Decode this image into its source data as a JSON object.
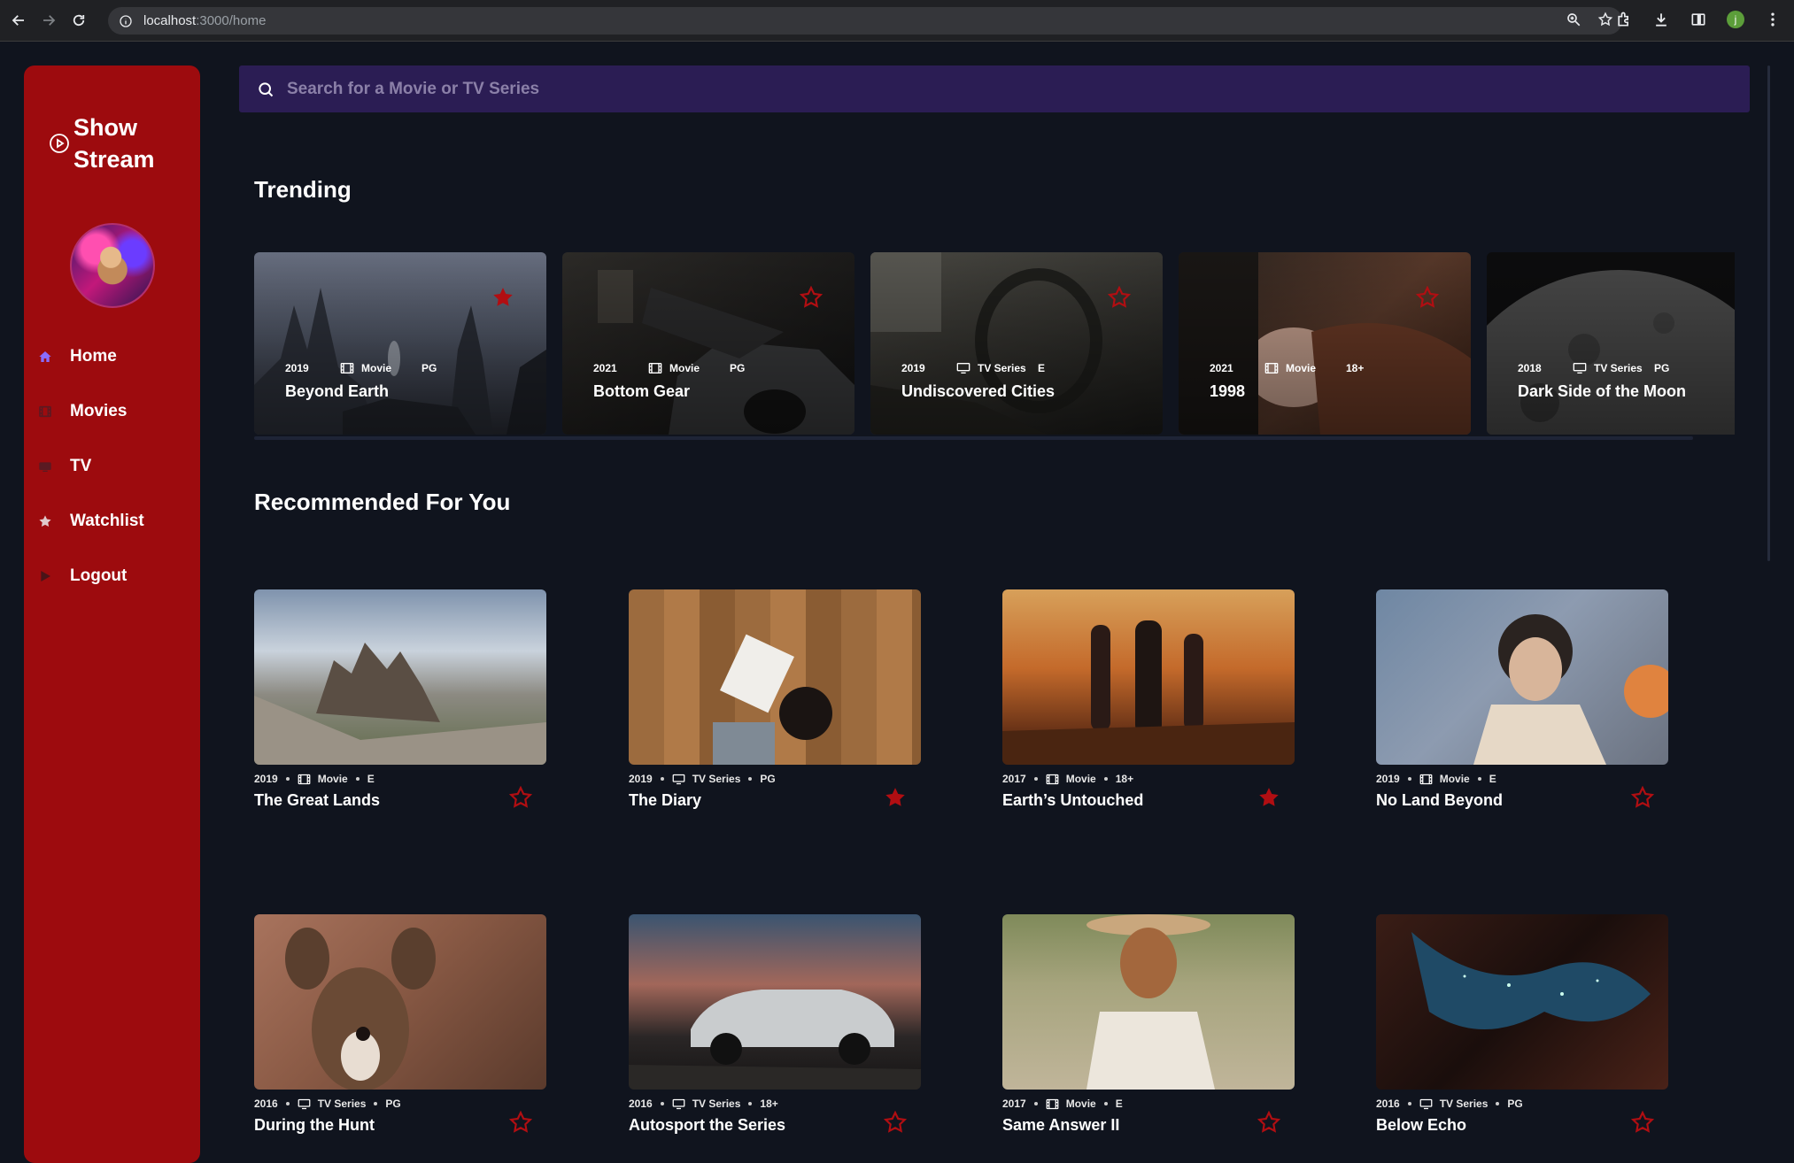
{
  "browser": {
    "url_host": "localhost",
    "url_path": ":3000/home"
  },
  "sidebar": {
    "logo_text": "Show Stream",
    "nav": [
      {
        "label": "Home"
      },
      {
        "label": "Movies"
      },
      {
        "label": "TV"
      },
      {
        "label": "Watchlist"
      },
      {
        "label": "Logout"
      }
    ]
  },
  "search": {
    "placeholder": "Search for a Movie or TV Series"
  },
  "trending": {
    "title": "Trending",
    "items": [
      {
        "year": "2019",
        "type": "Movie",
        "rating": "PG",
        "title": "Beyond Earth",
        "bookmarked": true
      },
      {
        "year": "2021",
        "type": "Movie",
        "rating": "PG",
        "title": "Bottom Gear",
        "bookmarked": false
      },
      {
        "year": "2019",
        "type": "TV Series",
        "rating": "E",
        "title": "Undiscovered Cities",
        "bookmarked": false
      },
      {
        "year": "2021",
        "type": "Movie",
        "rating": "18+",
        "title": "1998",
        "bookmarked": false
      },
      {
        "year": "2018",
        "type": "TV Series",
        "rating": "PG",
        "title": "Dark Side of the Moon",
        "bookmarked": false
      }
    ]
  },
  "recommended": {
    "title": "Recommended For You",
    "items": [
      {
        "year": "2019",
        "type": "Movie",
        "rating": "E",
        "title": "The Great Lands",
        "bookmarked": false
      },
      {
        "year": "2019",
        "type": "TV Series",
        "rating": "PG",
        "title": "The Diary",
        "bookmarked": true
      },
      {
        "year": "2017",
        "type": "Movie",
        "rating": "18+",
        "title": "Earth’s Untouched",
        "bookmarked": true
      },
      {
        "year": "2019",
        "type": "Movie",
        "rating": "E",
        "title": "No Land Beyond",
        "bookmarked": false
      },
      {
        "year": "2016",
        "type": "TV Series",
        "rating": "PG",
        "title": "During the Hunt",
        "bookmarked": false
      },
      {
        "year": "2016",
        "type": "TV Series",
        "rating": "18+",
        "title": "Autosport the Series",
        "bookmarked": false
      },
      {
        "year": "2017",
        "type": "Movie",
        "rating": "E",
        "title": "Same Answer II",
        "bookmarked": false
      },
      {
        "year": "2016",
        "type": "TV Series",
        "rating": "PG",
        "title": "Below Echo",
        "bookmarked": false
      }
    ]
  },
  "colors": {
    "background": "#10141e",
    "sidebar": "#9d0b0e",
    "search_bg": "#2b1d54",
    "accent_star": "#b10e12",
    "home_icon": "#8a6cff"
  }
}
